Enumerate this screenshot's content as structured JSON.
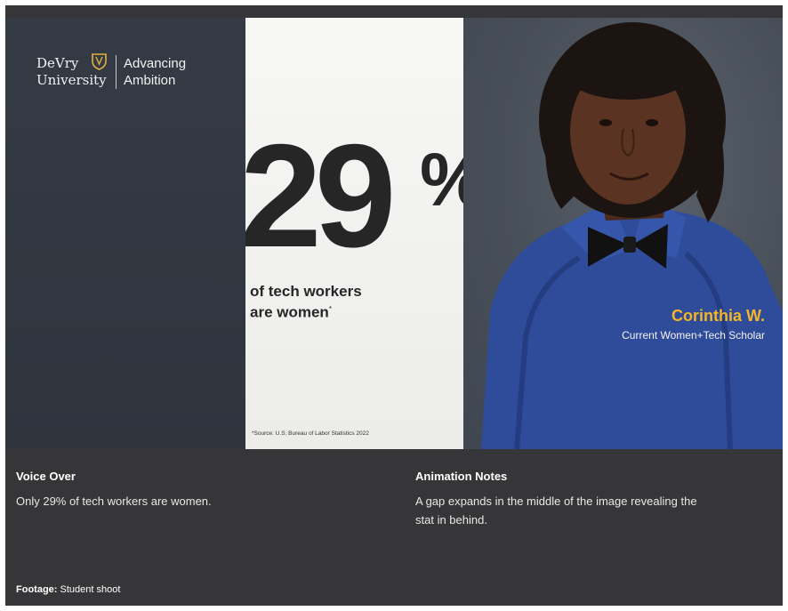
{
  "brand": {
    "name_line1": "DeVry",
    "name_line2": "University",
    "tagline_line1": "Advancing",
    "tagline_line2": "Ambition"
  },
  "stat": {
    "number": "29",
    "percent": "%",
    "caption_line1": "of tech workers",
    "caption_line2": "are women",
    "footnote_mark": "*",
    "source": "*Source: U.S. Bureau of Labor Statistics 2022"
  },
  "person": {
    "name": "Corinthia W.",
    "title": "Current Women+Tech Scholar"
  },
  "voice_over": {
    "label": "Voice Over",
    "text": "Only 29% of tech workers are women."
  },
  "animation_notes": {
    "label": "Animation Notes",
    "text_line1": "A gap expands in the middle of the image revealing the",
    "text_line2": "stat in behind."
  },
  "footage": {
    "label": "Footage:",
    "value": "Student shoot"
  },
  "colors": {
    "accent": "#f3b52a",
    "background": "#363638",
    "shirt": "#2f4c9a"
  }
}
